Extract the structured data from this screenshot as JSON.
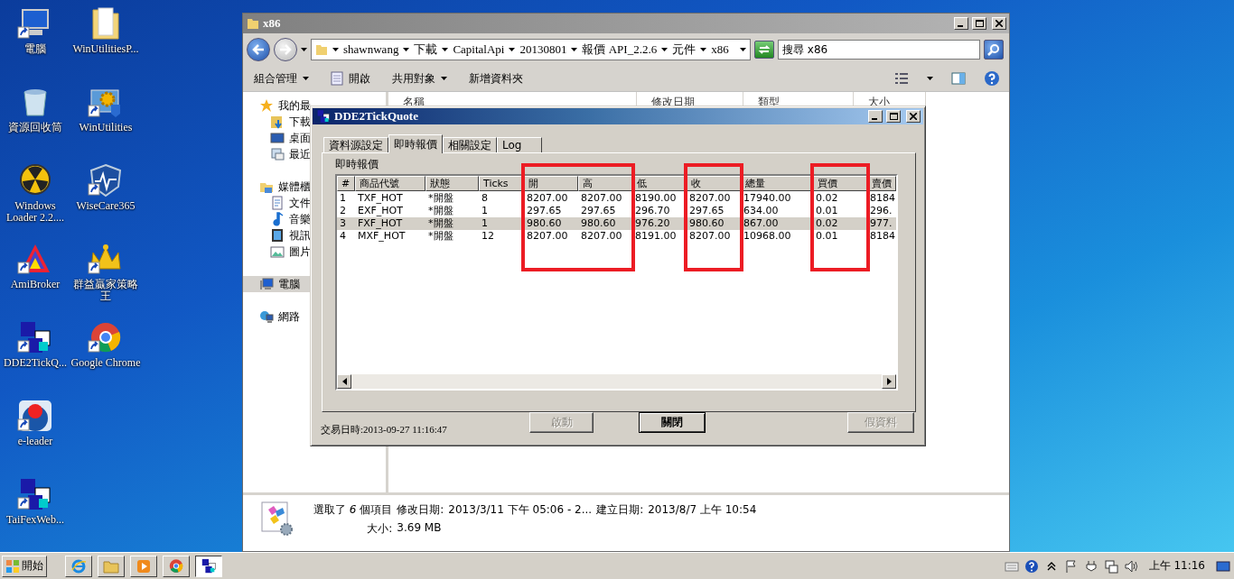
{
  "desktop": {
    "columns": [
      [
        {
          "label": "電腦",
          "kind": "computer",
          "shortcut": true
        },
        {
          "label": "資源回收筒",
          "kind": "recycle",
          "shortcut": false
        },
        {
          "label": "Windows Loader 2.2....",
          "kind": "radiation",
          "shortcut": false
        },
        {
          "label": "AmiBroker",
          "kind": "triangle",
          "shortcut": true
        },
        {
          "label": "DDE2TickQ...",
          "kind": "cubes",
          "shortcut": true
        },
        {
          "label": "e-leader",
          "kind": "ball",
          "shortcut": true
        },
        {
          "label": "TaiFexWeb...",
          "kind": "cubes",
          "shortcut": true
        }
      ],
      [
        {
          "label": "WinUtilitiesP...",
          "kind": "folder",
          "shortcut": false
        },
        {
          "label": "WinUtilities",
          "kind": "gear",
          "shortcut": true
        },
        {
          "label": "WiseCare365",
          "kind": "shield",
          "shortcut": true
        },
        {
          "label": "群益贏家策略王",
          "kind": "crown",
          "shortcut": true
        },
        {
          "label": "Google Chrome",
          "kind": "chrome",
          "shortcut": true
        }
      ]
    ]
  },
  "explorer": {
    "title": "x86",
    "address": [
      "shawnwang",
      "下載",
      "CapitalApi",
      "20130801",
      "報價 API_2.2.6",
      "元件",
      "x86"
    ],
    "search": {
      "placeholder": "搜尋 x86"
    },
    "toolbar": [
      {
        "label": "組合管理",
        "kind": "menu"
      },
      {
        "label": "開啟",
        "kind": "open"
      },
      {
        "label": "共用對象",
        "kind": "menu"
      },
      {
        "label": "新增資料夾",
        "kind": "plain"
      }
    ],
    "sidebar": [
      {
        "label": "我的最",
        "kind": "star",
        "selected": false,
        "children": [
          {
            "label": "下載",
            "kind": "download",
            "selected": false
          },
          {
            "label": "桌面",
            "kind": "monitor",
            "selected": false
          },
          {
            "label": "最近",
            "kind": "recent",
            "selected": false
          }
        ]
      },
      {
        "label": "媒體櫃",
        "kind": "library",
        "selected": false,
        "children": [
          {
            "label": "文件",
            "kind": "document",
            "selected": false
          },
          {
            "label": "音樂",
            "kind": "music",
            "selected": false
          },
          {
            "label": "視訊",
            "kind": "video",
            "selected": false
          },
          {
            "label": "圖片",
            "kind": "picture",
            "selected": false
          }
        ]
      },
      {
        "label": "電腦",
        "kind": "computer",
        "selected": true
      },
      {
        "label": "網路",
        "kind": "network",
        "selected": false
      }
    ],
    "columns": [
      "名稱",
      "修改日期",
      "類型",
      "大小"
    ],
    "details": {
      "summary": "選取了 *6* 個項目",
      "modified_label": "修改日期:",
      "modified": "2013/3/11 下午 05:06 - 2...",
      "created_label": "建立日期:",
      "created": "2013/8/7 上午 10:54",
      "size_label": "大小:",
      "size": "3.69 MB"
    }
  },
  "dialog": {
    "title": "DDE2TickQuote",
    "tabs": [
      {
        "label": "資料源設定",
        "selected": false
      },
      {
        "label": "即時報價",
        "selected": true
      },
      {
        "label": "相關設定",
        "selected": false
      },
      {
        "label": "Log",
        "selected": false
      }
    ],
    "group_label": "即時報價",
    "table": {
      "columns": [
        {
          "label": "#",
          "highlighted": false
        },
        {
          "label": "商品代號",
          "highlighted": false
        },
        {
          "label": "狀態",
          "highlighted": false
        },
        {
          "label": "Ticks",
          "highlighted": false
        },
        {
          "label": "開",
          "highlighted": true
        },
        {
          "label": "高",
          "highlighted": true
        },
        {
          "label": "低",
          "highlighted": false
        },
        {
          "label": "收",
          "highlighted": true
        },
        {
          "label": "總量",
          "highlighted": false
        },
        {
          "label": "買價",
          "highlighted": true
        },
        {
          "label": "賣價",
          "highlighted": false
        }
      ],
      "rows": [
        {
          "selected": false,
          "cells": [
            "1",
            "TXF_HOT",
            "*開盤",
            "8",
            "8207.00",
            "8207.00",
            "8190.00",
            "8207.00",
            "17940.00",
            "0.02",
            "8184"
          ]
        },
        {
          "selected": false,
          "cells": [
            "2",
            "EXF_HOT",
            "*開盤",
            "1",
            "297.65",
            "297.65",
            "296.70",
            "297.65",
            "634.00",
            "0.01",
            "296."
          ]
        },
        {
          "selected": true,
          "cells": [
            "3",
            "FXF_HOT",
            "*開盤",
            "1",
            "980.60",
            "980.60",
            "976.20",
            "980.60",
            "867.00",
            "0.02",
            "977."
          ]
        },
        {
          "selected": false,
          "cells": [
            "4",
            "MXF_HOT",
            "*開盤",
            "12",
            "8207.00",
            "8207.00",
            "8191.00",
            "8207.00",
            "10968.00",
            "0.01",
            "8184"
          ]
        }
      ]
    },
    "status": "交易日時:2013-09-27  11:16:47",
    "buttons": [
      {
        "label": "啟動",
        "disabled": true,
        "default": false
      },
      {
        "label": "關閉",
        "disabled": false,
        "default": true
      },
      {
        "label": "假資料",
        "disabled": true,
        "default": false
      }
    ]
  },
  "taskbar": {
    "start": "開始",
    "apps": [
      {
        "kind": "ie",
        "active": false
      },
      {
        "kind": "folder",
        "active": false
      },
      {
        "kind": "media",
        "active": false
      },
      {
        "kind": "chrome",
        "active": false
      },
      {
        "kind": "cubes",
        "active": true
      }
    ],
    "clock": "上午 11:16"
  }
}
